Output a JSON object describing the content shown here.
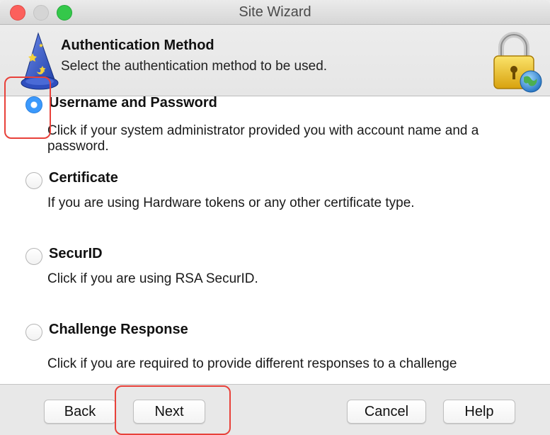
{
  "window": {
    "title": "Site Wizard"
  },
  "header": {
    "title": "Authentication Method",
    "subtitle": "Select the authentication method to be used."
  },
  "options": [
    {
      "label": "Username and Password",
      "description": "Click if your system administrator provided you with account name and a password.",
      "selected": true
    },
    {
      "label": "Certificate",
      "description": "If you are using Hardware tokens or any other certificate type.",
      "selected": false
    },
    {
      "label": "SecurID",
      "description": "Click if you are using RSA SecurID.",
      "selected": false
    },
    {
      "label": "Challenge Response",
      "description": "Click if you are required to provide different responses to a challenge",
      "selected": false
    }
  ],
  "footer": {
    "back_label": "Back",
    "next_label": "Next",
    "cancel_label": "Cancel",
    "help_label": "Help"
  },
  "colors": {
    "accent": "#3b99fc",
    "annotation": "#e8413a"
  },
  "icons": {
    "header_left": "wizard-hat-icon",
    "header_right": "lock-globe-icon"
  }
}
